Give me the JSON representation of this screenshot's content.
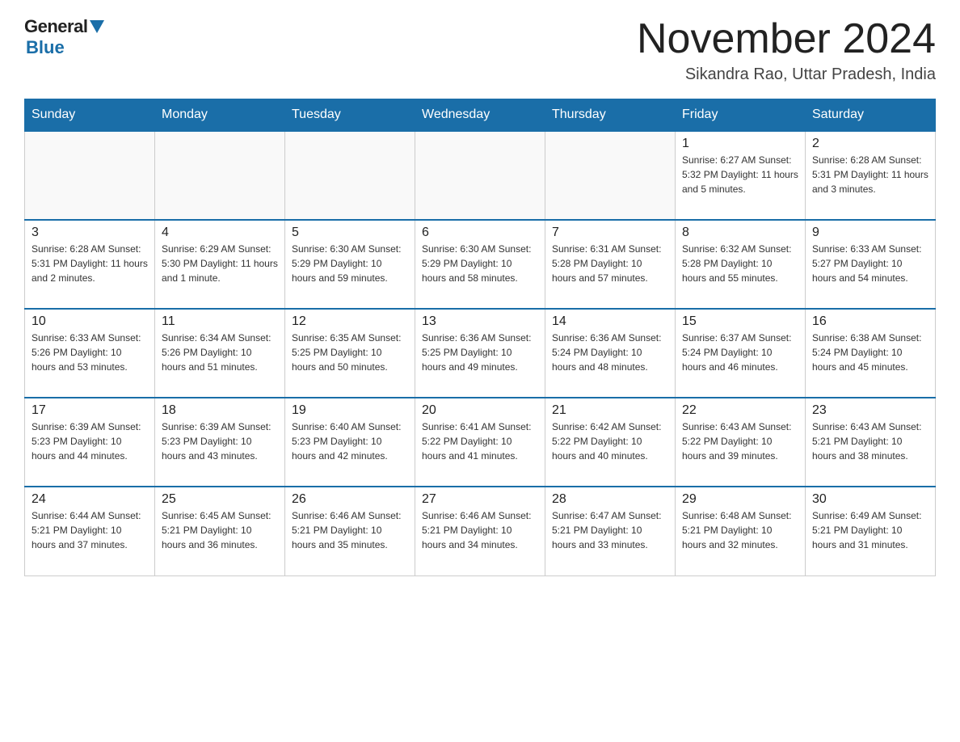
{
  "logo": {
    "general": "General",
    "blue": "Blue"
  },
  "title": "November 2024",
  "subtitle": "Sikandra Rao, Uttar Pradesh, India",
  "weekdays": [
    "Sunday",
    "Monday",
    "Tuesday",
    "Wednesday",
    "Thursday",
    "Friday",
    "Saturday"
  ],
  "weeks": [
    [
      {
        "day": "",
        "info": ""
      },
      {
        "day": "",
        "info": ""
      },
      {
        "day": "",
        "info": ""
      },
      {
        "day": "",
        "info": ""
      },
      {
        "day": "",
        "info": ""
      },
      {
        "day": "1",
        "info": "Sunrise: 6:27 AM\nSunset: 5:32 PM\nDaylight: 11 hours and 5 minutes."
      },
      {
        "day": "2",
        "info": "Sunrise: 6:28 AM\nSunset: 5:31 PM\nDaylight: 11 hours and 3 minutes."
      }
    ],
    [
      {
        "day": "3",
        "info": "Sunrise: 6:28 AM\nSunset: 5:31 PM\nDaylight: 11 hours and 2 minutes."
      },
      {
        "day": "4",
        "info": "Sunrise: 6:29 AM\nSunset: 5:30 PM\nDaylight: 11 hours and 1 minute."
      },
      {
        "day": "5",
        "info": "Sunrise: 6:30 AM\nSunset: 5:29 PM\nDaylight: 10 hours and 59 minutes."
      },
      {
        "day": "6",
        "info": "Sunrise: 6:30 AM\nSunset: 5:29 PM\nDaylight: 10 hours and 58 minutes."
      },
      {
        "day": "7",
        "info": "Sunrise: 6:31 AM\nSunset: 5:28 PM\nDaylight: 10 hours and 57 minutes."
      },
      {
        "day": "8",
        "info": "Sunrise: 6:32 AM\nSunset: 5:28 PM\nDaylight: 10 hours and 55 minutes."
      },
      {
        "day": "9",
        "info": "Sunrise: 6:33 AM\nSunset: 5:27 PM\nDaylight: 10 hours and 54 minutes."
      }
    ],
    [
      {
        "day": "10",
        "info": "Sunrise: 6:33 AM\nSunset: 5:26 PM\nDaylight: 10 hours and 53 minutes."
      },
      {
        "day": "11",
        "info": "Sunrise: 6:34 AM\nSunset: 5:26 PM\nDaylight: 10 hours and 51 minutes."
      },
      {
        "day": "12",
        "info": "Sunrise: 6:35 AM\nSunset: 5:25 PM\nDaylight: 10 hours and 50 minutes."
      },
      {
        "day": "13",
        "info": "Sunrise: 6:36 AM\nSunset: 5:25 PM\nDaylight: 10 hours and 49 minutes."
      },
      {
        "day": "14",
        "info": "Sunrise: 6:36 AM\nSunset: 5:24 PM\nDaylight: 10 hours and 48 minutes."
      },
      {
        "day": "15",
        "info": "Sunrise: 6:37 AM\nSunset: 5:24 PM\nDaylight: 10 hours and 46 minutes."
      },
      {
        "day": "16",
        "info": "Sunrise: 6:38 AM\nSunset: 5:24 PM\nDaylight: 10 hours and 45 minutes."
      }
    ],
    [
      {
        "day": "17",
        "info": "Sunrise: 6:39 AM\nSunset: 5:23 PM\nDaylight: 10 hours and 44 minutes."
      },
      {
        "day": "18",
        "info": "Sunrise: 6:39 AM\nSunset: 5:23 PM\nDaylight: 10 hours and 43 minutes."
      },
      {
        "day": "19",
        "info": "Sunrise: 6:40 AM\nSunset: 5:23 PM\nDaylight: 10 hours and 42 minutes."
      },
      {
        "day": "20",
        "info": "Sunrise: 6:41 AM\nSunset: 5:22 PM\nDaylight: 10 hours and 41 minutes."
      },
      {
        "day": "21",
        "info": "Sunrise: 6:42 AM\nSunset: 5:22 PM\nDaylight: 10 hours and 40 minutes."
      },
      {
        "day": "22",
        "info": "Sunrise: 6:43 AM\nSunset: 5:22 PM\nDaylight: 10 hours and 39 minutes."
      },
      {
        "day": "23",
        "info": "Sunrise: 6:43 AM\nSunset: 5:21 PM\nDaylight: 10 hours and 38 minutes."
      }
    ],
    [
      {
        "day": "24",
        "info": "Sunrise: 6:44 AM\nSunset: 5:21 PM\nDaylight: 10 hours and 37 minutes."
      },
      {
        "day": "25",
        "info": "Sunrise: 6:45 AM\nSunset: 5:21 PM\nDaylight: 10 hours and 36 minutes."
      },
      {
        "day": "26",
        "info": "Sunrise: 6:46 AM\nSunset: 5:21 PM\nDaylight: 10 hours and 35 minutes."
      },
      {
        "day": "27",
        "info": "Sunrise: 6:46 AM\nSunset: 5:21 PM\nDaylight: 10 hours and 34 minutes."
      },
      {
        "day": "28",
        "info": "Sunrise: 6:47 AM\nSunset: 5:21 PM\nDaylight: 10 hours and 33 minutes."
      },
      {
        "day": "29",
        "info": "Sunrise: 6:48 AM\nSunset: 5:21 PM\nDaylight: 10 hours and 32 minutes."
      },
      {
        "day": "30",
        "info": "Sunrise: 6:49 AM\nSunset: 5:21 PM\nDaylight: 10 hours and 31 minutes."
      }
    ]
  ]
}
